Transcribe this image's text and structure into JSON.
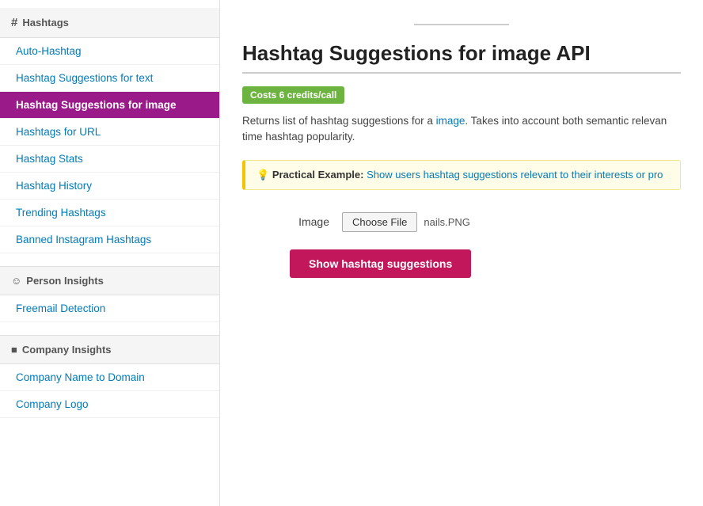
{
  "sidebar": {
    "sections": [
      {
        "id": "hashtags",
        "icon": "#",
        "label": "Hashtags",
        "items": [
          {
            "id": "auto-hashtag",
            "label": "Auto-Hashtag",
            "active": false
          },
          {
            "id": "hashtag-suggestions-text",
            "label": "Hashtag Suggestions for text",
            "active": false
          },
          {
            "id": "hashtag-suggestions-image",
            "label": "Hashtag Suggestions for image",
            "active": true
          },
          {
            "id": "hashtags-url",
            "label": "Hashtags for URL",
            "active": false
          },
          {
            "id": "hashtag-stats",
            "label": "Hashtag Stats",
            "active": false
          },
          {
            "id": "hashtag-history",
            "label": "Hashtag History",
            "active": false
          },
          {
            "id": "trending-hashtags",
            "label": "Trending Hashtags",
            "active": false
          },
          {
            "id": "banned-instagram-hashtags",
            "label": "Banned Instagram Hashtags",
            "active": false
          }
        ]
      },
      {
        "id": "person-insights",
        "icon": "person",
        "label": "Person Insights",
        "items": [
          {
            "id": "freemail-detection",
            "label": "Freemail Detection",
            "active": false
          }
        ]
      },
      {
        "id": "company-insights",
        "icon": "company",
        "label": "Company Insights",
        "items": [
          {
            "id": "company-name-to-domain",
            "label": "Company Name to Domain",
            "active": false
          },
          {
            "id": "company-logo",
            "label": "Company Logo",
            "active": false
          }
        ]
      }
    ]
  },
  "main": {
    "divider": true,
    "title": "Hashtag Suggestions for image API",
    "badge": "Costs 6 credits/call",
    "description": "Returns list of hashtag suggestions for a image. Takes into account both semantic relevan time hashtag popularity.",
    "practical_example_label": "Practical Example:",
    "practical_example_text": "Show users hashtag suggestions relevant to their interests or pro",
    "form": {
      "image_label": "Image",
      "choose_file_label": "Choose File",
      "file_name": "nails.PNG",
      "submit_label": "Show hashtag suggestions"
    }
  }
}
